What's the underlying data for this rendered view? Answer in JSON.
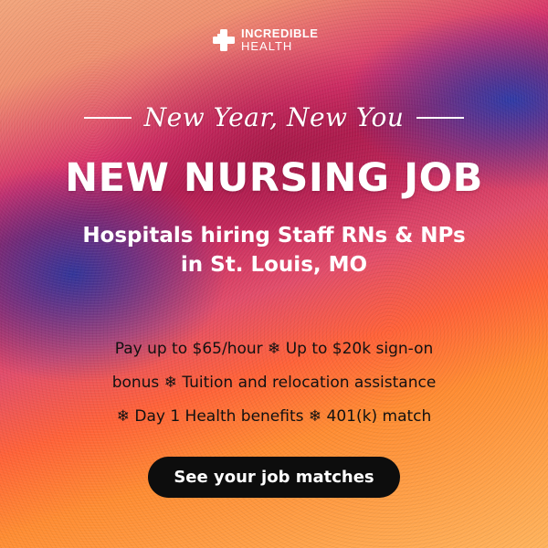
{
  "brand": {
    "name_line1": "INCREDIBLE",
    "name_line2": "HEALTH",
    "logo_icon": "medical-cross-icon"
  },
  "tagline": "New Year, New You",
  "headline": "NEW NURSING JOB",
  "subheadline": {
    "line1": "Hospitals hiring Staff RNs & NPs",
    "line2": "in St. Louis, MO"
  },
  "benefits": {
    "line1": "Pay up to $65/hour ❄ Up to $20k sign-on",
    "line2": "bonus ❄ Tuition and relocation assistance",
    "line3": "❄ Day 1 Health benefits ❄ 401(k) match"
  },
  "cta": {
    "label": "See your job matches"
  },
  "colors": {
    "cta_background": "#0d0d0d",
    "text_light": "#ffffff",
    "text_dark": "#111111"
  }
}
